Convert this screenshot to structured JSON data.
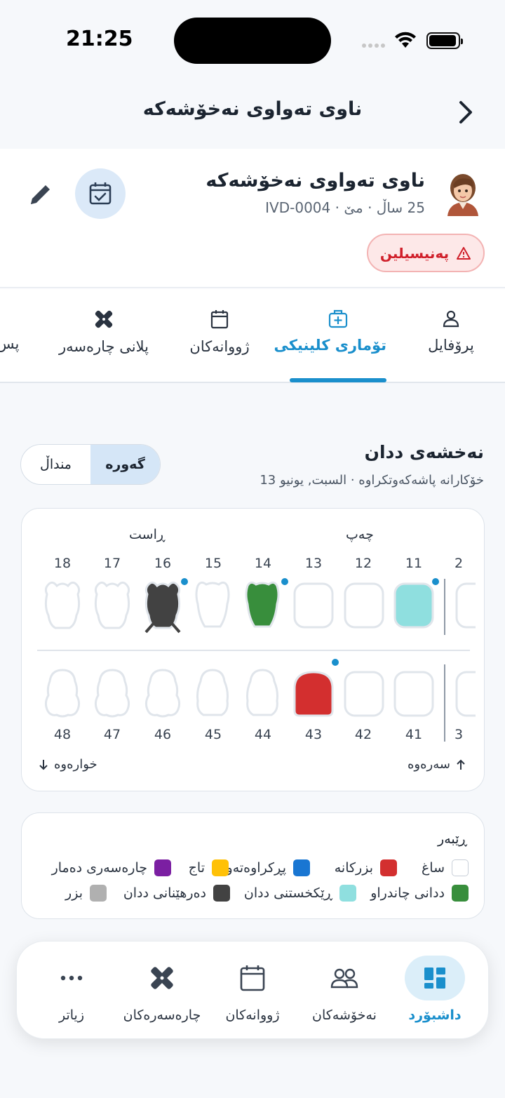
{
  "status": {
    "time": "21:25"
  },
  "header": {
    "title": "ناوی تەواوی نەخۆشەکە"
  },
  "patient": {
    "name": "ناوی تەواوی نەخۆشەکە",
    "meta": "25 ساڵ · مێ · IVD-0004",
    "allergy": "پەنیسیلین"
  },
  "tabs": [
    {
      "label": "پرۆفایل",
      "icon": "user-icon"
    },
    {
      "label": "تۆماری کلینیکی",
      "icon": "medical-kit-icon"
    },
    {
      "label": "ژووانەکان",
      "icon": "calendar-icon"
    },
    {
      "label": "پلانی چارەسەر",
      "icon": "bandage-icon"
    },
    {
      "label": "پس",
      "icon": ""
    }
  ],
  "chart": {
    "title": "نەخشەی ددان",
    "subtitle": "خۆکارانە پاشەکەوتکراوە · السبت, يونيو 13",
    "segment_adult": "گەورە",
    "segment_child": "منداڵ",
    "side_left": "چەپ",
    "side_right": "ڕاست",
    "upper_label": "سەرەوە",
    "lower_label": "خوارەوە",
    "upper_numbers": [
      "11",
      "12",
      "13",
      "14",
      "15",
      "16",
      "17",
      "18"
    ],
    "lower_numbers": [
      "41",
      "42",
      "43",
      "44",
      "45",
      "46",
      "47",
      "48"
    ],
    "cut_upper": "2",
    "cut_lower": "3"
  },
  "legend": {
    "title": "ڕێبەر",
    "items": [
      {
        "label": "ساغ",
        "color": "#ffffff"
      },
      {
        "label": "بزرکانە",
        "color": "#d32f2f"
      },
      {
        "label": "پڕکراوەتەوە",
        "color": "#1976d2"
      },
      {
        "label": "تاج",
        "color": "#ffc107"
      },
      {
        "label": "چارەسەری دەمار",
        "color": "#7b1fa2"
      },
      {
        "label": "ددانی چاندراو",
        "color": "#388e3c"
      },
      {
        "label": "ڕێکخستنی ددان",
        "color": "#8fdfdf"
      },
      {
        "label": "دەرهێنانی ددان",
        "color": "#424242"
      },
      {
        "label": "بزر",
        "color": "#b0b0b0"
      }
    ]
  },
  "bottom_nav": [
    {
      "label": "داشبۆرد",
      "icon": "dashboard-icon"
    },
    {
      "label": "نەخۆشەکان",
      "icon": "patients-icon"
    },
    {
      "label": "ژووانەکان",
      "icon": "calendar-icon"
    },
    {
      "label": "چارەسەرەکان",
      "icon": "bandage-icon"
    },
    {
      "label": "زیاتر",
      "icon": "more-icon"
    }
  ]
}
